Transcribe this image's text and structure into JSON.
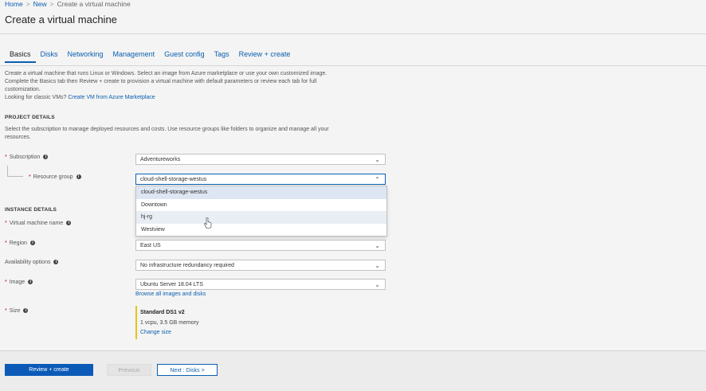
{
  "breadcrumb": {
    "home": "Home",
    "new": "New",
    "current": "Create a virtual machine"
  },
  "page_title": "Create a virtual machine",
  "tabs": [
    {
      "label": "Basics",
      "active": true
    },
    {
      "label": "Disks"
    },
    {
      "label": "Networking"
    },
    {
      "label": "Management"
    },
    {
      "label": "Guest config"
    },
    {
      "label": "Tags"
    },
    {
      "label": "Review + create"
    }
  ],
  "intro": {
    "line1": "Create a virtual machine that runs Linux or Windows. Select an image from Azure marketplace or use your own customized image.",
    "line2": "Complete the Basics tab then Review + create to provision a virtual machine with default parameters or review each tab for full",
    "line3": "customization.",
    "classic_prefix": "Looking for classic VMs?",
    "classic_link": "Create VM from Azure Marketplace"
  },
  "project": {
    "heading": "PROJECT DETAILS",
    "desc1": "Select the subscription to manage deployed resources and costs. Use resource groups like folders to organize and manage all your",
    "desc2": "resources.",
    "subscription_label": "Subscription",
    "subscription_value": "Adventureworks",
    "rg_label": "Resource group",
    "rg_value": "cloud-shell-storage-westus",
    "rg_options": [
      "cloud-shell-storage-westus",
      "Downtown",
      "hj-rg",
      "Westview"
    ]
  },
  "instance": {
    "heading": "INSTANCE DETAILS",
    "vm_name_label": "Virtual machine name",
    "region_label": "Region",
    "region_value": "East US",
    "availability_label": "Availability options",
    "availability_value": "No infrastructure redundancy required",
    "image_label": "Image",
    "image_value": "Ubuntu Server 18.04 LTS",
    "browse_link": "Browse all images and disks",
    "size_label": "Size",
    "size_name": "Standard DS1 v2",
    "size_specs": "1 vcpu, 3.5 GB memory",
    "change_size": "Change size"
  },
  "footer": {
    "review_create": "Review + create",
    "previous": "Previous",
    "next": "Next : Disks >"
  },
  "icons": {
    "info": "info-icon",
    "chevron": "chevron-down-icon",
    "cursor": "hand-pointer-icon"
  },
  "colors": {
    "accent": "#0a5fb0",
    "primary_button": "#0b5ab8",
    "size_marker": "#e8c31c",
    "required": "#c00000"
  }
}
